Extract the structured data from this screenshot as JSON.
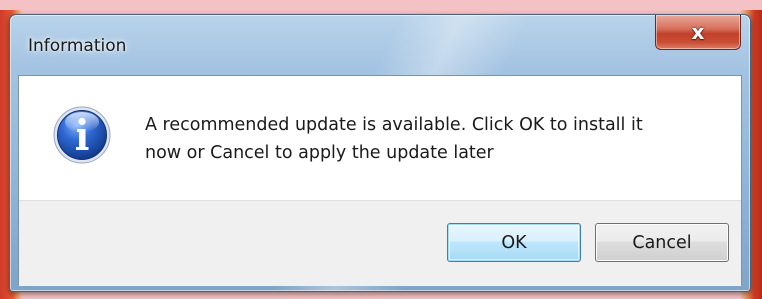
{
  "window": {
    "title": "Information",
    "close_glyph": "x",
    "close_icon": "close-icon"
  },
  "dialog": {
    "icon": "info-icon",
    "message": "A recommended update is available. Click OK to install it\nnow or Cancel to apply the update later",
    "ok_label": "OK",
    "cancel_label": "Cancel"
  },
  "colors": {
    "titlebar": "#a3c3e2",
    "close_button": "#c94d35",
    "info_icon_blue": "#1f4fb0",
    "button_area": "#f0f0f0",
    "default_button_border": "#3c7fb1"
  }
}
